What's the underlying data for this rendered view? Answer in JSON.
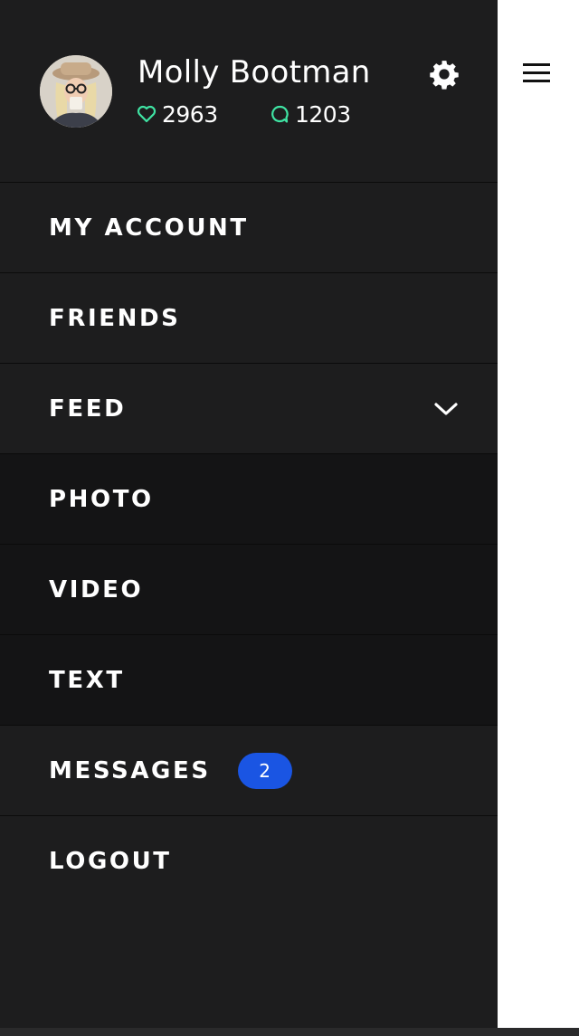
{
  "profile": {
    "name": "Molly Bootman",
    "likes": "2963",
    "comments": "1203",
    "avatar_icon": "user-avatar-photo",
    "settings_icon": "gear-icon"
  },
  "menu": {
    "items": [
      {
        "label": "MY ACCOUNT"
      },
      {
        "label": "FRIENDS"
      },
      {
        "label": "FEED",
        "expanded": true
      },
      {
        "label": "PHOTO"
      },
      {
        "label": "VIDEO"
      },
      {
        "label": "TEXT"
      },
      {
        "label": "MESSAGES",
        "badge": "2"
      },
      {
        "label": "LOGOUT"
      }
    ]
  },
  "colors": {
    "drawer_background": "#1d1d1e",
    "submenu_background": "#141415",
    "accent_green": "#3fe3a3",
    "badge_blue": "#1a55e3"
  }
}
